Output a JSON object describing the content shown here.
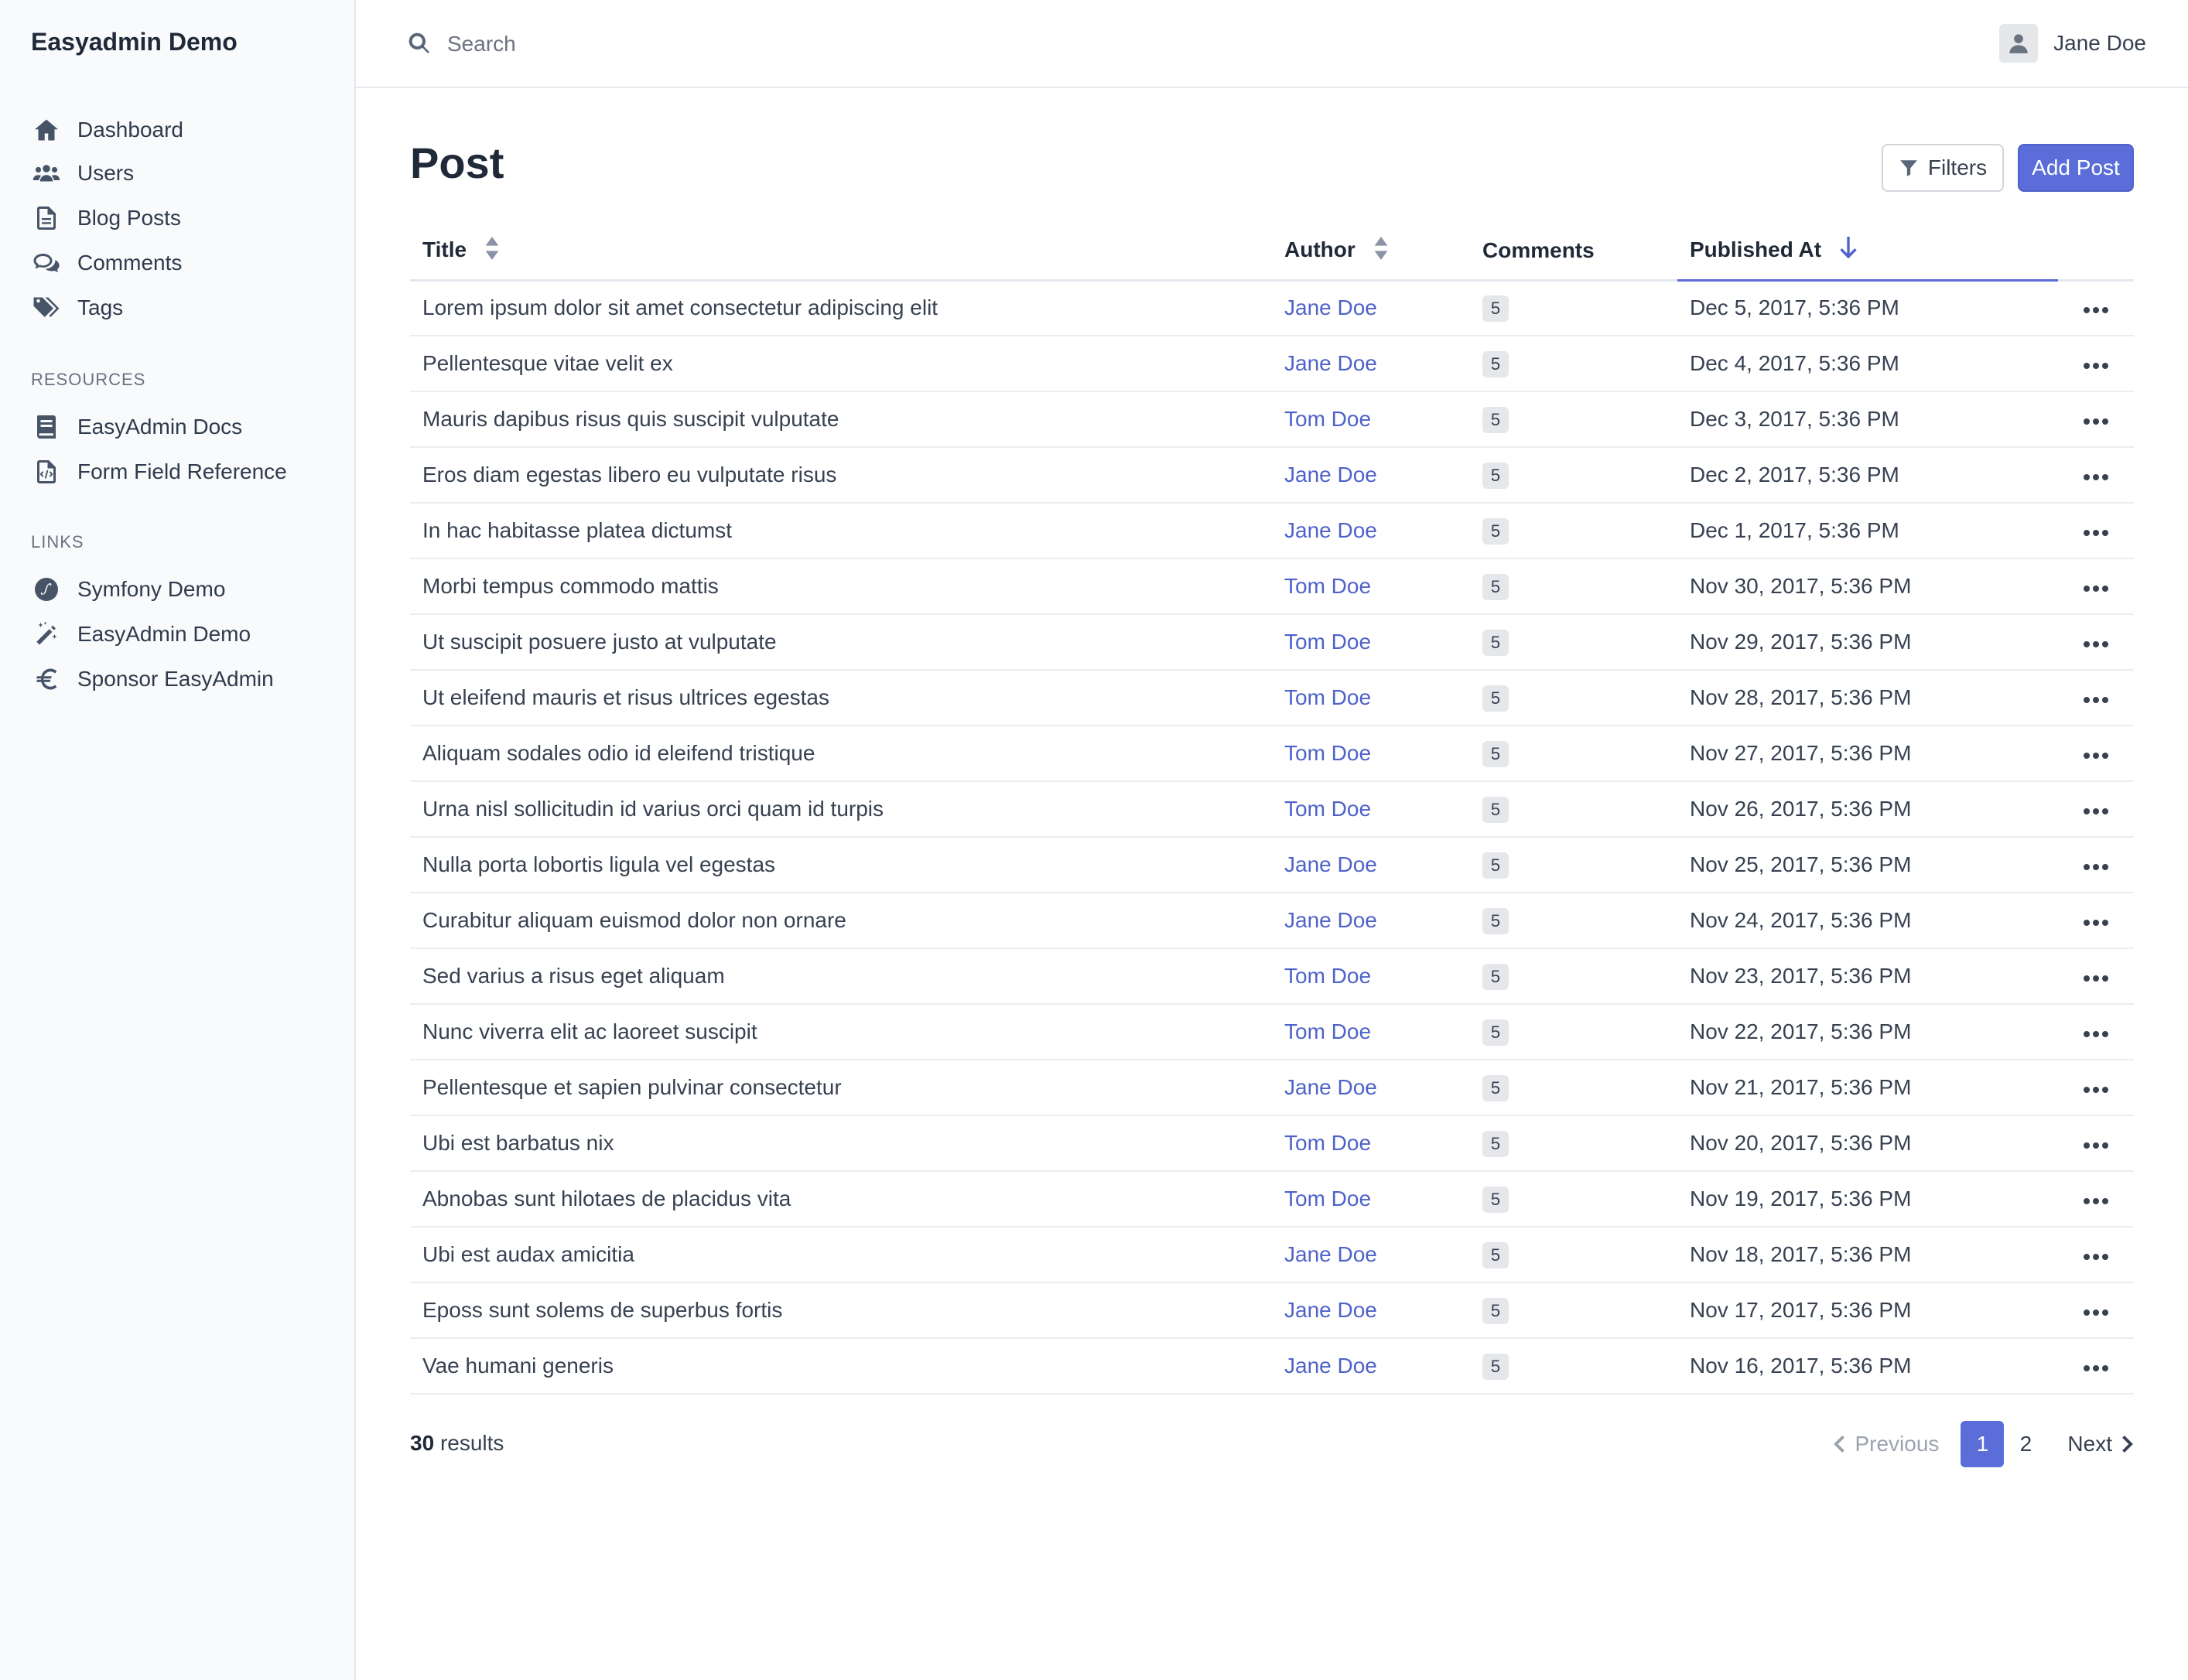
{
  "app": {
    "brand": "Easyadmin Demo"
  },
  "sidebar": {
    "items": [
      {
        "label": "Dashboard",
        "icon": "home-icon"
      },
      {
        "label": "Users",
        "icon": "users-icon"
      },
      {
        "label": "Blog Posts",
        "icon": "file-text-icon"
      },
      {
        "label": "Comments",
        "icon": "comments-icon"
      },
      {
        "label": "Tags",
        "icon": "tags-icon"
      }
    ],
    "resources_header": "RESOURCES",
    "resources": [
      {
        "label": "EasyAdmin Docs",
        "icon": "book-icon"
      },
      {
        "label": "Form Field Reference",
        "icon": "file-code-icon"
      }
    ],
    "links_header": "LINKS",
    "links": [
      {
        "label": "Symfony Demo",
        "icon": "symfony-icon"
      },
      {
        "label": "EasyAdmin Demo",
        "icon": "magic-wand-icon"
      },
      {
        "label": "Sponsor EasyAdmin",
        "icon": "euro-icon"
      }
    ]
  },
  "topbar": {
    "search_placeholder": "Search",
    "user_name": "Jane Doe"
  },
  "page": {
    "title": "Post",
    "filters_label": "Filters",
    "add_label": "Add Post"
  },
  "table": {
    "columns": [
      "Title",
      "Author",
      "Comments",
      "Published At"
    ],
    "rows": [
      {
        "title": "Lorem ipsum dolor sit amet consectetur adipiscing elit",
        "author": "Jane Doe",
        "comments": "5",
        "published": "Dec 5, 2017, 5:36 PM"
      },
      {
        "title": "Pellentesque vitae velit ex",
        "author": "Jane Doe",
        "comments": "5",
        "published": "Dec 4, 2017, 5:36 PM"
      },
      {
        "title": "Mauris dapibus risus quis suscipit vulputate",
        "author": "Tom Doe",
        "comments": "5",
        "published": "Dec 3, 2017, 5:36 PM"
      },
      {
        "title": "Eros diam egestas libero eu vulputate risus",
        "author": "Jane Doe",
        "comments": "5",
        "published": "Dec 2, 2017, 5:36 PM"
      },
      {
        "title": "In hac habitasse platea dictumst",
        "author": "Jane Doe",
        "comments": "5",
        "published": "Dec 1, 2017, 5:36 PM"
      },
      {
        "title": "Morbi tempus commodo mattis",
        "author": "Tom Doe",
        "comments": "5",
        "published": "Nov 30, 2017, 5:36 PM"
      },
      {
        "title": "Ut suscipit posuere justo at vulputate",
        "author": "Tom Doe",
        "comments": "5",
        "published": "Nov 29, 2017, 5:36 PM"
      },
      {
        "title": "Ut eleifend mauris et risus ultrices egestas",
        "author": "Tom Doe",
        "comments": "5",
        "published": "Nov 28, 2017, 5:36 PM"
      },
      {
        "title": "Aliquam sodales odio id eleifend tristique",
        "author": "Tom Doe",
        "comments": "5",
        "published": "Nov 27, 2017, 5:36 PM"
      },
      {
        "title": "Urna nisl sollicitudin id varius orci quam id turpis",
        "author": "Tom Doe",
        "comments": "5",
        "published": "Nov 26, 2017, 5:36 PM"
      },
      {
        "title": "Nulla porta lobortis ligula vel egestas",
        "author": "Jane Doe",
        "comments": "5",
        "published": "Nov 25, 2017, 5:36 PM"
      },
      {
        "title": "Curabitur aliquam euismod dolor non ornare",
        "author": "Jane Doe",
        "comments": "5",
        "published": "Nov 24, 2017, 5:36 PM"
      },
      {
        "title": "Sed varius a risus eget aliquam",
        "author": "Tom Doe",
        "comments": "5",
        "published": "Nov 23, 2017, 5:36 PM"
      },
      {
        "title": "Nunc viverra elit ac laoreet suscipit",
        "author": "Tom Doe",
        "comments": "5",
        "published": "Nov 22, 2017, 5:36 PM"
      },
      {
        "title": "Pellentesque et sapien pulvinar consectetur",
        "author": "Jane Doe",
        "comments": "5",
        "published": "Nov 21, 2017, 5:36 PM"
      },
      {
        "title": "Ubi est barbatus nix",
        "author": "Tom Doe",
        "comments": "5",
        "published": "Nov 20, 2017, 5:36 PM"
      },
      {
        "title": "Abnobas sunt hilotaes de placidus vita",
        "author": "Tom Doe",
        "comments": "5",
        "published": "Nov 19, 2017, 5:36 PM"
      },
      {
        "title": "Ubi est audax amicitia",
        "author": "Jane Doe",
        "comments": "5",
        "published": "Nov 18, 2017, 5:36 PM"
      },
      {
        "title": "Eposs sunt solems de superbus fortis",
        "author": "Jane Doe",
        "comments": "5",
        "published": "Nov 17, 2017, 5:36 PM"
      },
      {
        "title": "Vae humani generis",
        "author": "Jane Doe",
        "comments": "5",
        "published": "Nov 16, 2017, 5:36 PM"
      }
    ]
  },
  "footer": {
    "results_count": "30",
    "results_label": "results",
    "pagination": {
      "previous": "Previous",
      "pages": [
        "1",
        "2"
      ],
      "current": "1",
      "next": "Next"
    }
  },
  "colors": {
    "accent": "#5a6dd8",
    "link": "#4f62c9",
    "sidebar_bg": "#f8fafc"
  }
}
